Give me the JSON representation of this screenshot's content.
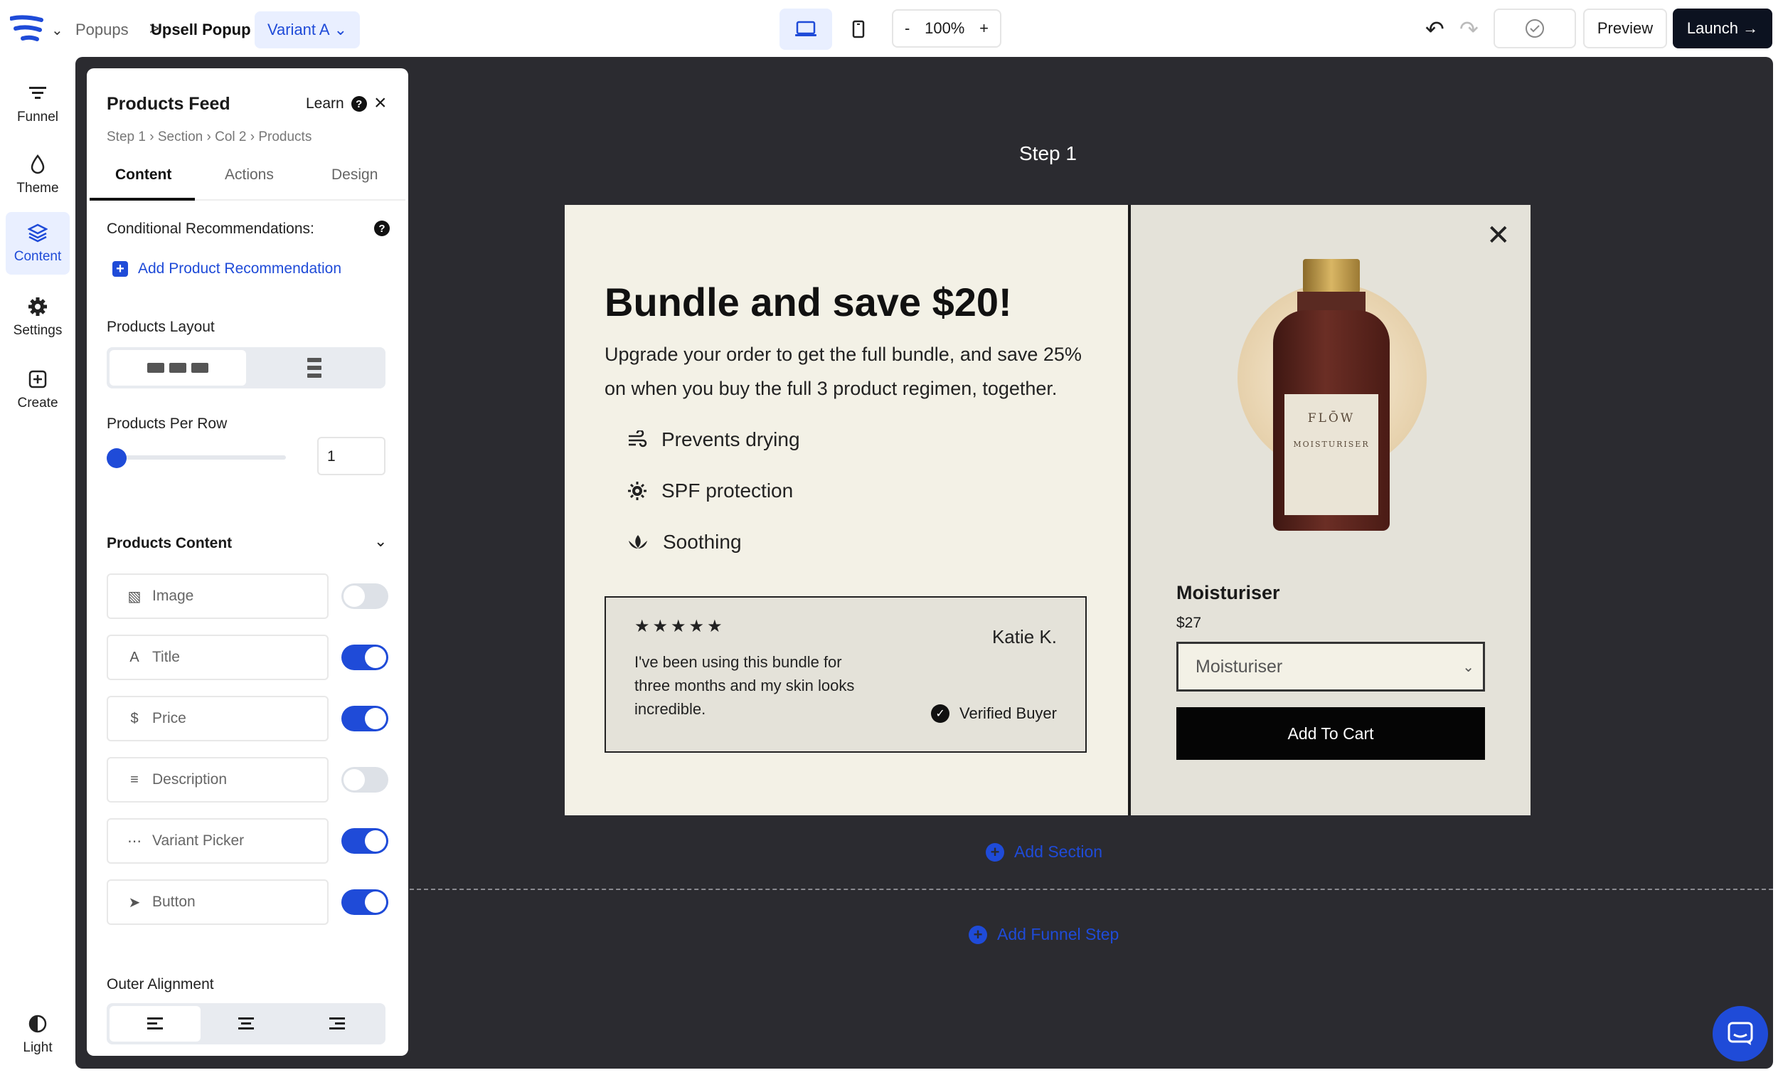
{
  "topbar": {
    "breadcrumb_root": "Popups",
    "breadcrumb_sep": ">",
    "breadcrumb_current": "Upsell Popup",
    "variant": "Variant A",
    "zoom_minus": "-",
    "zoom_value": "100%",
    "zoom_plus": "+",
    "preview": "Preview",
    "launch": "Launch →"
  },
  "rail": {
    "items": [
      {
        "label": "Funnel",
        "icon": "funnel-icon"
      },
      {
        "label": "Theme",
        "icon": "droplet-icon"
      },
      {
        "label": "Content",
        "icon": "layers-icon"
      },
      {
        "label": "Settings",
        "icon": "gear-icon"
      },
      {
        "label": "Create",
        "icon": "plus-square-icon"
      }
    ],
    "theme_toggle": "Light"
  },
  "panel": {
    "title": "Products Feed",
    "learn": "Learn",
    "breadcrumbs": [
      "Step 1",
      "Section",
      "Col 2",
      "Products"
    ],
    "tabs": [
      "Content",
      "Actions",
      "Design"
    ],
    "conditional_label": "Conditional Recommendations:",
    "add_recommendation": "Add Product Recommendation",
    "layout_label": "Products Layout",
    "per_row_label": "Products Per Row",
    "per_row_value": "1",
    "per_row_slider_fraction": 0,
    "content_label": "Products Content",
    "content_rows": [
      {
        "label": "Image",
        "icon": "image-icon",
        "enabled": false
      },
      {
        "label": "Title",
        "icon": "text-icon",
        "enabled": true
      },
      {
        "label": "Price",
        "icon": "dollar-icon",
        "enabled": true
      },
      {
        "label": "Description",
        "icon": "align-left-icon",
        "enabled": false
      },
      {
        "label": "Variant Picker",
        "icon": "dots-icon",
        "enabled": true
      },
      {
        "label": "Button",
        "icon": "cursor-icon",
        "enabled": true
      }
    ],
    "alignment_label": "Outer Alignment"
  },
  "canvas": {
    "step_label": "Step 1",
    "headline": "Bundle and save $20!",
    "subtext": "Upgrade your order to get the full bundle, and save 25% on when you buy the full 3 product regimen, together.",
    "features": [
      {
        "label": "Prevents drying",
        "icon": "wind-icon"
      },
      {
        "label": "SPF protection",
        "icon": "sun-icon"
      },
      {
        "label": "Soothing",
        "icon": "lotus-icon"
      }
    ],
    "review": {
      "stars": "★★★★★",
      "rating": 5,
      "text": "I've been using this bundle for three months and my skin looks incredible.",
      "name": "Katie K.",
      "verified": "Verified Buyer"
    },
    "bottle_brand": "FLŌW",
    "bottle_product": "MOISTURISER",
    "product_title": "Moisturiser",
    "product_price": "$27",
    "variant_selected": "Moisturiser",
    "add_to_cart": "Add To Cart",
    "add_section": "Add Section",
    "add_funnel_step": "Add Funnel Step"
  },
  "colors": {
    "accent": "#1f4bd8",
    "stage": "#2b2b30",
    "popup_bg": "#f3f1e6",
    "launch_bg": "#0c1220"
  }
}
